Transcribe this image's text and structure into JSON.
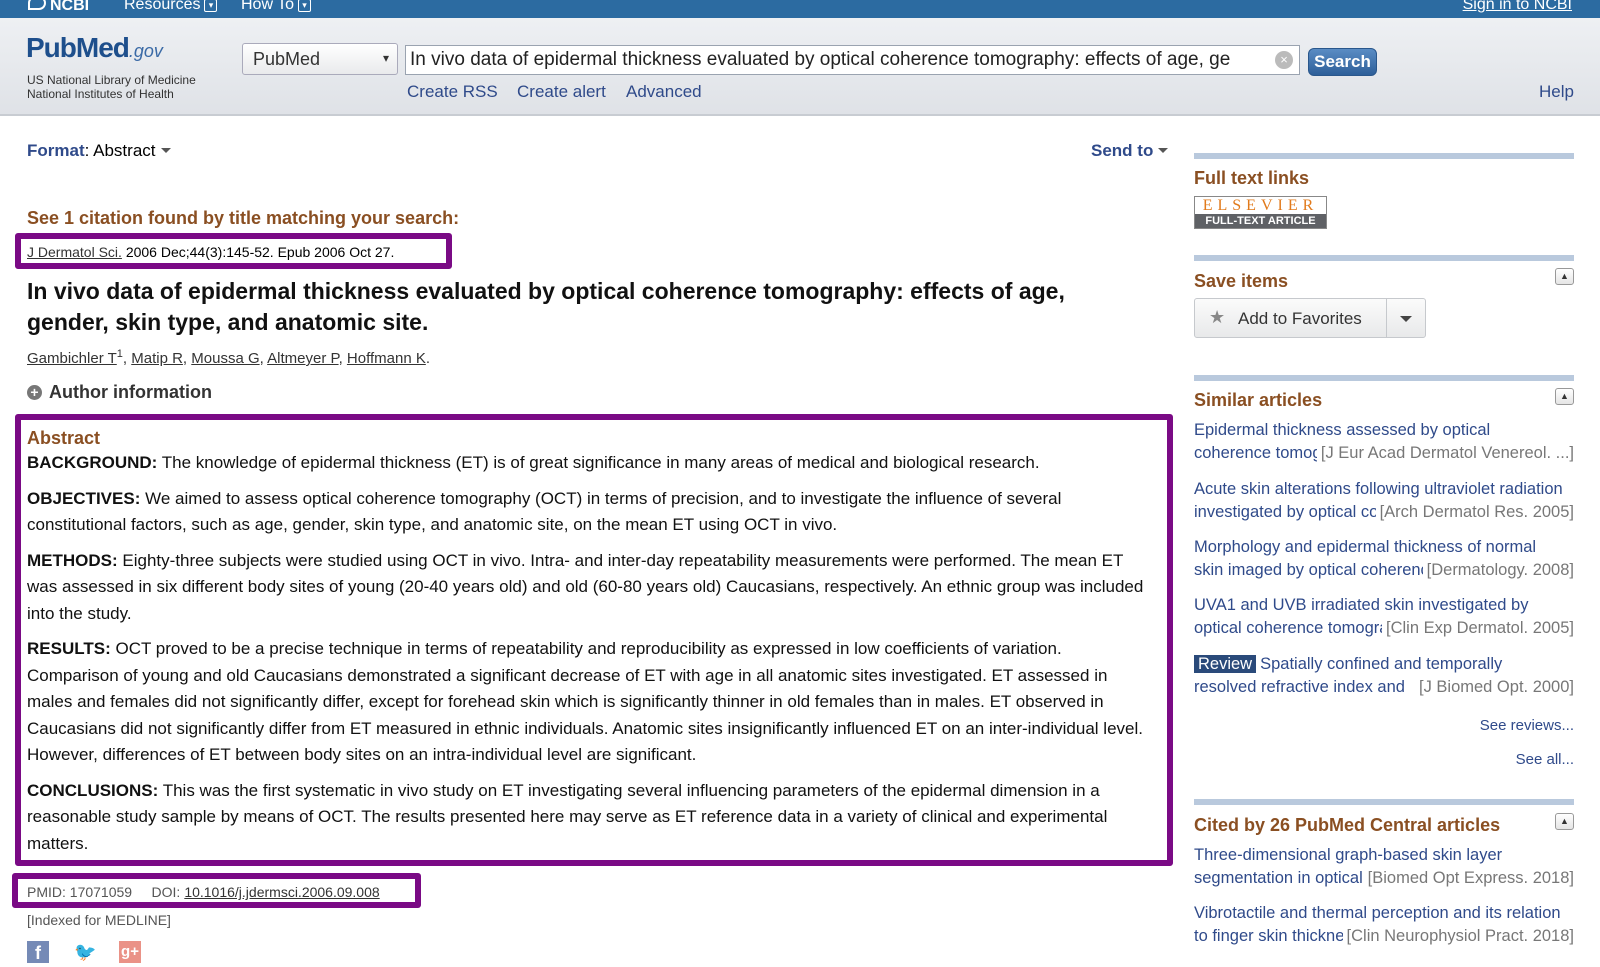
{
  "topbar": {
    "logo": "NCBI",
    "resources": "Resources",
    "howto": "How To",
    "signin": "Sign in to NCBI"
  },
  "header": {
    "logo_pub": "Pub",
    "logo_med": "Med",
    "logo_gov": ".gov",
    "sub1": "US National Library of Medicine",
    "sub2": "National Institutes of Health",
    "db_selected": "PubMed",
    "search_value": "In vivo data of epidermal thickness evaluated by optical coherence tomography: effects of age, ge",
    "search_button": "Search",
    "links": [
      "Create RSS",
      "Create alert",
      "Advanced"
    ],
    "help": "Help"
  },
  "main": {
    "format_label": "Format",
    "format_value": "Abstract",
    "send_to": "Send to",
    "citation_heading": "See 1 citation found by title matching your search:",
    "journal": "J Dermatol Sci.",
    "journal_rest": "2006 Dec;44(3):145-52. Epub 2006 Oct 27.",
    "title": "In vivo data of epidermal thickness evaluated by optical coherence tomography: effects of age, gender, skin type, and anatomic site.",
    "authors": [
      "Gambichler T",
      "Matip R",
      "Moussa G",
      "Altmeyer P",
      "Hoffmann K"
    ],
    "author_sup": "1",
    "author_info": "Author information",
    "abstract_heading": "Abstract",
    "abstract": [
      {
        "label": "BACKGROUND:",
        "text": "The knowledge of epidermal thickness (ET) is of great significance in many areas of medical and biological research."
      },
      {
        "label": "OBJECTIVES:",
        "text": "We aimed to assess optical coherence tomography (OCT) in terms of precision, and to investigate the influence of several constitutional factors, such as age, gender, skin type, and anatomic site, on the mean ET using OCT in vivo."
      },
      {
        "label": "METHODS:",
        "text": "Eighty-three subjects were studied using OCT in vivo. Intra- and inter-day repeatability measurements were performed. The mean ET was assessed in six different body sites of young (20-40 years old) and old (60-80 years old) Caucasians, respectively. An ethnic group was included into the study."
      },
      {
        "label": "RESULTS:",
        "text": "OCT proved to be a precise technique in terms of repeatability and reproducibility as expressed in low coefficients of variation. Comparison of young and old Caucasians demonstrated a significant decrease of ET with age in all anatomic sites investigated. ET assessed in males and females did not significantly differ, except for forehead skin which is significantly thinner in old females than in males. ET observed in Caucasians did not significantly differ from ET measured in ethnic individuals. Anatomic sites insignificantly influenced ET on an inter-individual level. However, differences of ET between body sites on an intra-individual level are significant."
      },
      {
        "label": "CONCLUSIONS:",
        "text": "This was the first systematic in vivo study on ET investigating several influencing parameters of the epidermal dimension in a reasonable study sample by means of OCT. The results presented here may serve as ET reference data in a variety of clinical and experimental matters."
      }
    ],
    "pmid": "PMID: 17071059",
    "doi_label": "DOI:",
    "doi": "10.1016/j.jdermsci.2006.09.008",
    "indexed": "[Indexed for MEDLINE]"
  },
  "sidebar": {
    "full_text_heading": "Full text links",
    "elsevier_top": "ELSEVIER",
    "elsevier_bottom": "FULL-TEXT ARTICLE",
    "save_heading": "Save items",
    "add_favorites": "Add to Favorites",
    "similar_heading": "Similar articles",
    "similar": [
      {
        "l1": "Epidermal thickness assessed by optical",
        "l2": "coherence tomography",
        "journal": "[J Eur Acad Dermatol Venereol. ...]"
      },
      {
        "l1": "Acute skin alterations following ultraviolet radiation",
        "l2": "investigated by optical coherence",
        "journal": "[Arch Dermatol Res. 2005]"
      },
      {
        "l1": "Morphology and epidermal thickness of normal",
        "l2": "skin imaged by optical coherence",
        "journal": "[Dermatology. 2008]"
      },
      {
        "l1": "UVA1 and UVB irradiated skin investigated by",
        "l2": "optical coherence tomography",
        "journal": "[Clin Exp Dermatol. 2005]"
      },
      {
        "badge": "Review",
        "l1": "Spatially confined and temporally",
        "l2": "resolved refractive index and",
        "journal": "[J Biomed Opt. 2000]"
      }
    ],
    "see_reviews": "See reviews...",
    "see_all": "See all...",
    "cited_heading": "Cited by 26 PubMed Central articles",
    "cited": [
      {
        "l1": "Three-dimensional graph-based skin layer",
        "l2": "segmentation in optical",
        "journal": "[Biomed Opt Express. 2018]"
      },
      {
        "l1": "Vibrotactile and thermal perception and its relation",
        "l2": "to finger skin thickness",
        "journal": "[Clin Neurophysiol Pract. 2018]"
      }
    ]
  },
  "colors": {
    "highlight": "#7a0a85",
    "heading_brown": "#8a4f22",
    "link_blue": "#2f4a8a",
    "ncbi_bar": "#2c6ba1"
  }
}
